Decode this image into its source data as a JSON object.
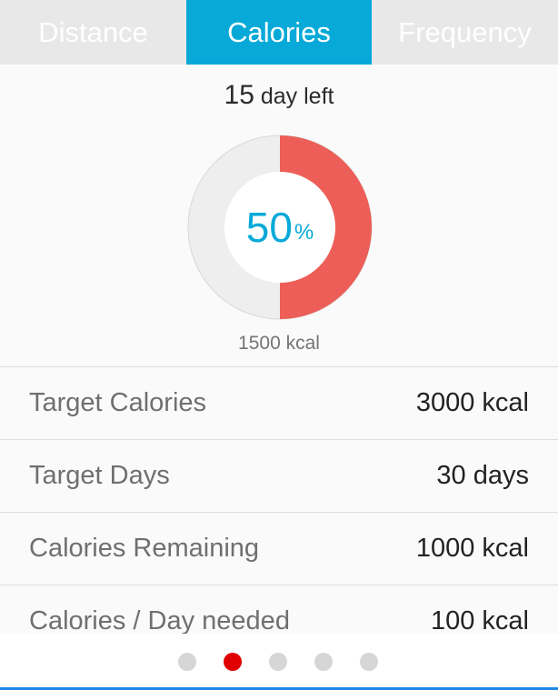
{
  "tabs": [
    {
      "label": "Distance"
    },
    {
      "label": "Calories",
      "active": true
    },
    {
      "label": "Frequency"
    }
  ],
  "summary": {
    "days_left_number": "15",
    "days_left_text": " day left",
    "progress_value": "50",
    "progress_symbol": "%",
    "progress_fraction": 0.5,
    "current_kcal": "1500 kcal"
  },
  "rows": [
    {
      "label": "Target Calories",
      "value": "3000 kcal"
    },
    {
      "label": "Target Days",
      "value": "30 days"
    },
    {
      "label": "Calories Remaining",
      "value": "1000 kcal"
    },
    {
      "label": "Calories / Day needed",
      "value": "100 kcal"
    }
  ],
  "pager": {
    "count": 5,
    "active_index": 1
  },
  "colors": {
    "accent": "#06a9d8",
    "progress": "#ec5e57",
    "track": "#eeeeee",
    "active_dot": "#e00000",
    "inactive_dot": "#d6d6d6"
  }
}
